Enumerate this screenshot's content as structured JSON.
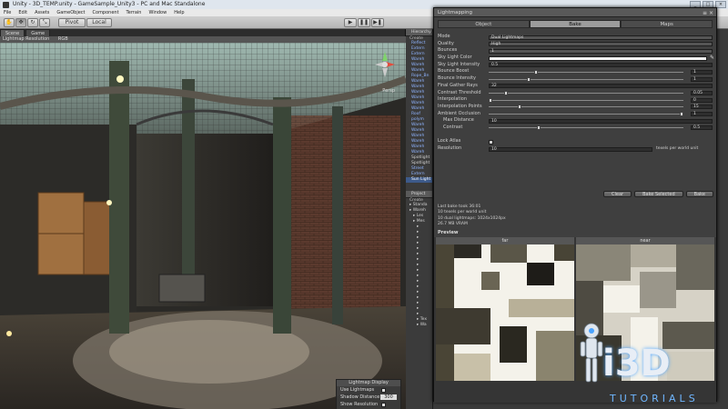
{
  "window": {
    "title": "Unity - 3D_TEMP.unity - GameSample_Unity3 - PC and Mac Standalone",
    "controls": [
      "_",
      "□",
      "×"
    ]
  },
  "menu": [
    "File",
    "Edit",
    "Assets",
    "GameObject",
    "Component",
    "Terrain",
    "Window",
    "Help"
  ],
  "toolbar": {
    "pivot_label": "Pivot",
    "local_label": "Local",
    "play_icon": "play-icon",
    "pause_icon": "pause-icon",
    "step_icon": "step-icon"
  },
  "scene": {
    "tabs": [
      "Scene",
      "Game"
    ],
    "bar_items": [
      "Lightmap Resolution",
      "RGB"
    ],
    "persp_label": "Persp"
  },
  "lightmap_display": {
    "title": "Lightmap Display",
    "use_lightmaps_label": "Use Lightmaps",
    "shadow_distance_label": "Shadow Distance",
    "shadow_distance_value": "300",
    "show_resolution_label": "Show Resolution"
  },
  "hierarchy": {
    "tab": "Hierarchy",
    "create": "Create",
    "items": [
      {
        "label": "Reflect",
        "color": "blue"
      },
      {
        "label": "Extern",
        "color": "blue"
      },
      {
        "label": "Extern",
        "color": "blue"
      },
      {
        "label": "Wareh",
        "color": "blue"
      },
      {
        "label": "Wareh",
        "color": "blue"
      },
      {
        "label": "Wareh",
        "color": "blue"
      },
      {
        "label": "Rope_Bn",
        "color": "blue"
      },
      {
        "label": "Wareh",
        "color": "blue"
      },
      {
        "label": "Wareh",
        "color": "blue"
      },
      {
        "label": "Wareh",
        "color": "blue"
      },
      {
        "label": "Wareh",
        "color": "blue"
      },
      {
        "label": "Wareh",
        "color": "blue"
      },
      {
        "label": "Wareh",
        "color": "blue"
      },
      {
        "label": "Roof",
        "color": "blue"
      },
      {
        "label": "polym",
        "color": "blue"
      },
      {
        "label": "Wareh",
        "color": "blue"
      },
      {
        "label": "Wareh",
        "color": "blue"
      },
      {
        "label": "Wareh",
        "color": "blue"
      },
      {
        "label": "Wareh",
        "color": "blue"
      },
      {
        "label": "Wareh",
        "color": "blue"
      },
      {
        "label": "Wareh",
        "color": "blue"
      },
      {
        "label": "Spotlight",
        "color": "white"
      },
      {
        "label": "Spotlight",
        "color": "white"
      },
      {
        "label": "Street",
        "color": "blue"
      },
      {
        "label": "Extern",
        "color": "blue"
      },
      {
        "label": "Sun Light",
        "color": "selected"
      }
    ]
  },
  "project": {
    "tab": "Project",
    "create": "Create",
    "items": [
      "Standa",
      "Wareh",
      "Les",
      "Mes",
      "",
      "",
      "",
      "",
      "",
      "",
      "",
      "",
      "",
      "",
      "",
      "",
      "",
      "",
      "",
      "",
      "",
      "Tex",
      "Wa"
    ]
  },
  "lightmapping": {
    "title": "Lightmapping",
    "tabs": [
      "Object",
      "Bake",
      "Maps"
    ],
    "active_tab": "Bake",
    "mode_label": "Mode",
    "mode_value": "Dual Lightmaps",
    "quality_label": "Quality",
    "quality_value": "High",
    "bounces_label": "Bounces",
    "bounces_value": "1",
    "sky_light_color_label": "Sky Light Color",
    "sky_light_intensity_label": "Sky Light Intensity",
    "sky_light_intensity_value": "0.5",
    "bounce_boost_label": "Bounce Boost",
    "bounce_boost_value": "1",
    "bounce_intensity_label": "Bounce Intensity",
    "bounce_intensity_value": "1",
    "final_gather_rays_label": "Final Gather Rays",
    "final_gather_rays_value": "32",
    "contrast_threshold_label": "Contrast Threshold",
    "contrast_threshold_value": "0.05",
    "interpolation_label": "Interpolation",
    "interpolation_value": "0",
    "interpolation_points_label": "Interpolation Points",
    "interpolation_points_value": "15",
    "ambient_occlusion_label": "Ambient Occlusion",
    "ambient_occlusion_value": "1",
    "max_distance_label": "Max Distance",
    "max_distance_value": "10",
    "contrast_label": "Contrast",
    "contrast_value": "0.5",
    "lock_atlas_label": "Lock Atlas",
    "resolution_label": "Resolution",
    "resolution_value": "10",
    "resolution_suffix": "texels per world unit",
    "slider_levels": {
      "bounce_boost": 0.24,
      "bounce_intensity": 0.2,
      "contrast_threshold": 0.08,
      "interpolation": 0.0,
      "interpolation_points": 0.15,
      "ambient_occlusion": 1.0,
      "contrast": 0.25
    },
    "buttons": {
      "clear": "Clear",
      "bake_selected": "Bake Selected",
      "bake": "Bake"
    },
    "stats": [
      "Last bake took 36:01",
      "10 texels per world unit",
      "10 dual lightmaps: 1024x1024px",
      "26.7 MB VRAM"
    ],
    "preview_label": "Preview",
    "preview_far": "far",
    "preview_near": "near"
  },
  "logo": {
    "big_text": "i3D",
    "sub_text": "TUTORIALS"
  }
}
